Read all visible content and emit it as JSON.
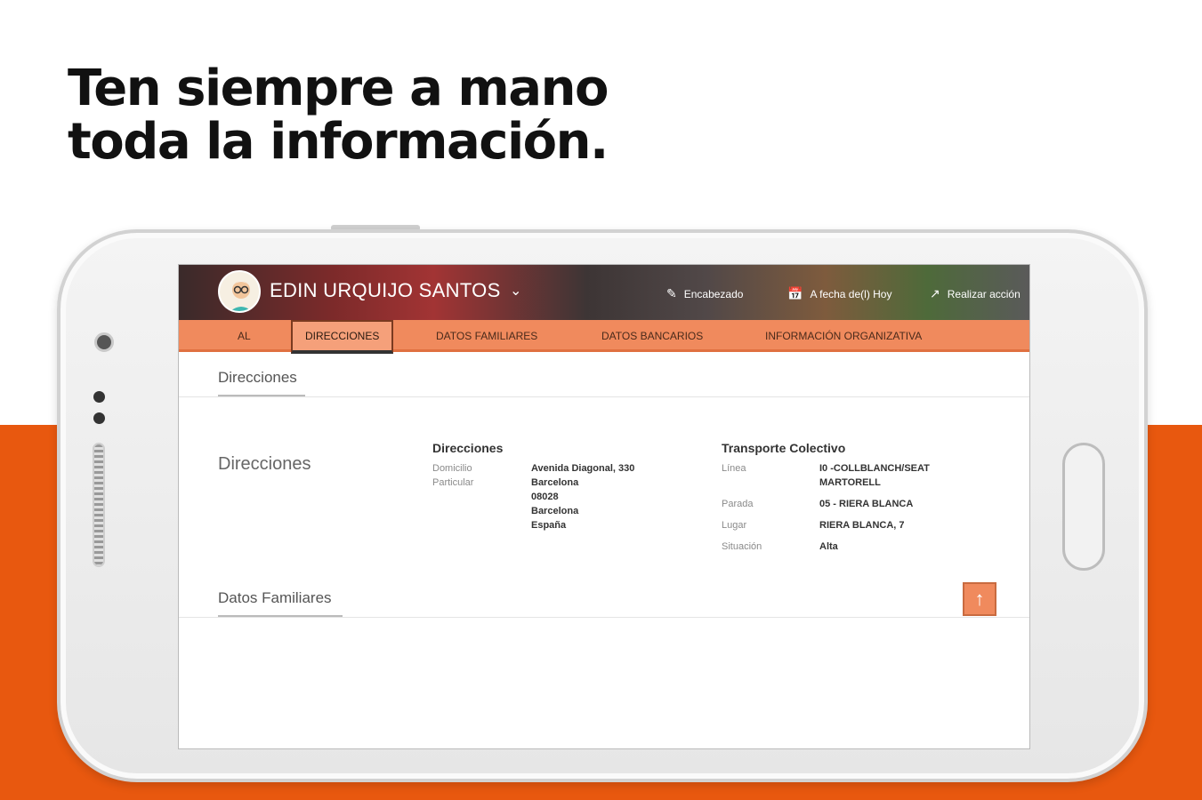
{
  "headline": {
    "line1": "Ten siempre a mano",
    "line2": "toda la información."
  },
  "colors": {
    "brand_orange": "#e8580f",
    "tab_orange": "#f08a5d"
  },
  "app": {
    "user_name": "EDIN URQUIJO SANTOS",
    "header_actions": [
      {
        "icon": "pencil-icon",
        "label": "Encabezado"
      },
      {
        "icon": "calendar-icon",
        "label": "A fecha de(l) Hoy"
      },
      {
        "icon": "share-icon",
        "label": "Realizar acción"
      }
    ],
    "tabs": [
      {
        "label": "AL",
        "active": false
      },
      {
        "label": "DIRECCIONES",
        "active": true
      },
      {
        "label": "DATOS FAMILIARES",
        "active": false
      },
      {
        "label": "DATOS BANCARIOS",
        "active": false
      },
      {
        "label": "INFORMACIÓN ORGANIZATIVA",
        "active": false
      }
    ],
    "section_direcciones_title": "Direcciones",
    "section_direcciones_label": "Direcciones",
    "direcciones": {
      "title": "Direcciones",
      "label": "Domicilio Particular",
      "address_lines": [
        "Avenida Diagonal, 330",
        "Barcelona",
        "08028",
        "Barcelona",
        "España"
      ]
    },
    "transporte": {
      "title": "Transporte Colectivo",
      "fields": [
        {
          "label": "Línea",
          "value": "I0 -COLLBLANCH/SEAT MARTORELL"
        },
        {
          "label": "Parada",
          "value": "05 - RIERA BLANCA"
        },
        {
          "label": "Lugar",
          "value": "RIERA BLANCA, 7"
        },
        {
          "label": "Situación",
          "value": "Alta"
        }
      ]
    },
    "section_familiares_title": "Datos Familiares",
    "scroll_top_icon": "arrow-up-icon"
  }
}
